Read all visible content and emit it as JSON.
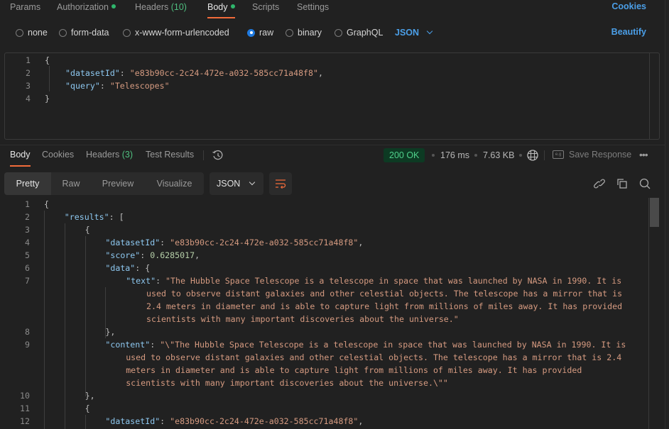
{
  "request": {
    "tabs": [
      {
        "label": "Params",
        "dot": false
      },
      {
        "label": "Authorization",
        "dot": true
      },
      {
        "label": "Headers",
        "count": "(10)"
      },
      {
        "label": "Body",
        "dot": true,
        "active": true
      },
      {
        "label": "Scripts"
      },
      {
        "label": "Settings"
      }
    ],
    "cookies_label": "Cookies",
    "body_types": [
      {
        "label": "none",
        "checked": false
      },
      {
        "label": "form-data",
        "checked": false
      },
      {
        "label": "x-www-form-urlencoded",
        "checked": false
      },
      {
        "label": "raw",
        "checked": true
      },
      {
        "label": "binary",
        "checked": false
      },
      {
        "label": "GraphQL",
        "checked": false
      }
    ],
    "raw_format": "JSON",
    "beautify_label": "Beautify",
    "editor_lines": [
      {
        "n": "1",
        "segments": [
          {
            "t": "{",
            "c": "punc"
          }
        ]
      },
      {
        "n": "2",
        "segments": [
          {
            "t": "\"datasetId\"",
            "c": "key"
          },
          {
            "t": ": ",
            "c": "punc"
          },
          {
            "t": "\"e83b90cc-2c24-472e-a032-585cc71a48f8\"",
            "c": "str"
          },
          {
            "t": ",",
            "c": "punc"
          }
        ]
      },
      {
        "n": "3",
        "segments": [
          {
            "t": "\"query\"",
            "c": "key"
          },
          {
            "t": ": ",
            "c": "punc"
          },
          {
            "t": "\"Telescopes\"",
            "c": "str"
          }
        ]
      },
      {
        "n": "4",
        "segments": [
          {
            "t": "}",
            "c": "punc"
          }
        ]
      }
    ]
  },
  "response": {
    "tabs": [
      {
        "label": "Body",
        "active": true
      },
      {
        "label": "Cookies"
      },
      {
        "label": "Headers",
        "count": "(3)"
      },
      {
        "label": "Test Results"
      }
    ],
    "history_icon": "history-icon",
    "status": "200 OK",
    "status_color": "#4fd18b",
    "time": "176 ms",
    "size": "7.63 KB",
    "globe_icon": "globe-icon",
    "save_response_label": "Save Response",
    "more_label": "•••",
    "view_modes": [
      {
        "label": "Pretty",
        "active": true
      },
      {
        "label": "Raw"
      },
      {
        "label": "Preview"
      },
      {
        "label": "Visualize"
      }
    ],
    "format": "JSON",
    "toolbar_icons": [
      "link-icon",
      "copy-icon",
      "search-icon"
    ],
    "lines": [
      {
        "n": "1",
        "indent": 0,
        "segments": [
          {
            "t": "{",
            "c": "punc"
          }
        ]
      },
      {
        "n": "2",
        "indent": 1,
        "segments": [
          {
            "t": "\"results\"",
            "c": "key"
          },
          {
            "t": ": [",
            "c": "punc"
          }
        ]
      },
      {
        "n": "3",
        "indent": 2,
        "segments": [
          {
            "t": "{",
            "c": "punc"
          }
        ]
      },
      {
        "n": "4",
        "indent": 3,
        "segments": [
          {
            "t": "\"datasetId\"",
            "c": "key"
          },
          {
            "t": ": ",
            "c": "punc"
          },
          {
            "t": "\"e83b90cc-2c24-472e-a032-585cc71a48f8\"",
            "c": "str"
          },
          {
            "t": ",",
            "c": "punc"
          }
        ]
      },
      {
        "n": "5",
        "indent": 3,
        "segments": [
          {
            "t": "\"score\"",
            "c": "key"
          },
          {
            "t": ": ",
            "c": "punc"
          },
          {
            "t": "0.6285017",
            "c": "num"
          },
          {
            "t": ",",
            "c": "punc"
          }
        ]
      },
      {
        "n": "6",
        "indent": 3,
        "segments": [
          {
            "t": "\"data\"",
            "c": "key"
          },
          {
            "t": ": {",
            "c": "punc"
          }
        ]
      },
      {
        "n": "7",
        "indent": 4,
        "segments": [
          {
            "t": "\"text\"",
            "c": "key"
          },
          {
            "t": ": ",
            "c": "punc"
          },
          {
            "t": "\"The Hubble Space Telescope is a telescope in space that was launched by NASA in 1990. It is",
            "c": "str"
          }
        ]
      },
      {
        "n": "",
        "indent": 5,
        "segments": [
          {
            "t": "used to observe distant galaxies and other celestial objects. The telescope has a mirror that is",
            "c": "str"
          }
        ]
      },
      {
        "n": "",
        "indent": 5,
        "segments": [
          {
            "t": "2.4 meters in diameter and is able to capture light from millions of miles away. It has provided",
            "c": "str"
          }
        ]
      },
      {
        "n": "",
        "indent": 5,
        "segments": [
          {
            "t": "scientists with many important discoveries about the universe.\"",
            "c": "str"
          }
        ]
      },
      {
        "n": "8",
        "indent": 3,
        "segments": [
          {
            "t": "},",
            "c": "punc"
          }
        ]
      },
      {
        "n": "9",
        "indent": 3,
        "segments": [
          {
            "t": "\"content\"",
            "c": "key"
          },
          {
            "t": ": ",
            "c": "punc"
          },
          {
            "t": "\"\\\"The Hubble Space Telescope is a telescope in space that was launched by NASA in 1990. It is",
            "c": "str"
          }
        ]
      },
      {
        "n": "",
        "indent": 4,
        "segments": [
          {
            "t": "used to observe distant galaxies and other celestial objects. The telescope has a mirror that is 2.4",
            "c": "str"
          }
        ]
      },
      {
        "n": "",
        "indent": 4,
        "segments": [
          {
            "t": "meters in diameter and is able to capture light from millions of miles away. It has provided",
            "c": "str"
          }
        ]
      },
      {
        "n": "",
        "indent": 4,
        "segments": [
          {
            "t": "scientists with many important discoveries about the universe.\\\"\"",
            "c": "str"
          }
        ]
      },
      {
        "n": "10",
        "indent": 2,
        "segments": [
          {
            "t": "},",
            "c": "punc"
          }
        ]
      },
      {
        "n": "11",
        "indent": 2,
        "segments": [
          {
            "t": "{",
            "c": "punc"
          }
        ]
      },
      {
        "n": "12",
        "indent": 3,
        "segments": [
          {
            "t": "\"datasetId\"",
            "c": "key"
          },
          {
            "t": ": ",
            "c": "punc"
          },
          {
            "t": "\"e83b90cc-2c24-472e-a032-585cc71a48f8\"",
            "c": "str"
          },
          {
            "t": ",",
            "c": "punc"
          }
        ]
      }
    ]
  }
}
